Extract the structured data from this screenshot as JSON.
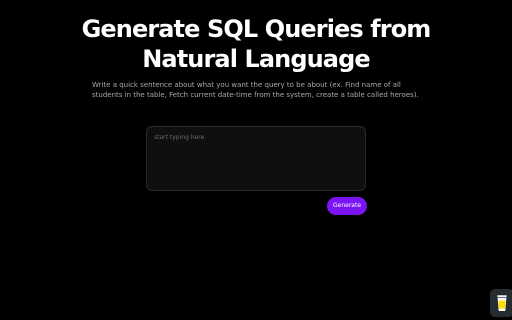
{
  "header": {
    "title_line1": "Generate SQL Queries from",
    "title_line2": "Natural Language",
    "description": "Write a quick sentence about what you want the query to be about (ex. Find name of all students in the table, Fetch current date-time from the system, create a table called heroes)."
  },
  "query_input": {
    "placeholder": "start typing here",
    "value": ""
  },
  "actions": {
    "generate_label": "Generate"
  },
  "floating_widget": {
    "icon": "coffee-cup-icon"
  },
  "colors": {
    "background": "#000000",
    "accent": "#7b14f2",
    "input_background": "#0f0f0f",
    "widget_background": "#262b30",
    "widget_cup": "#ffdd00"
  }
}
